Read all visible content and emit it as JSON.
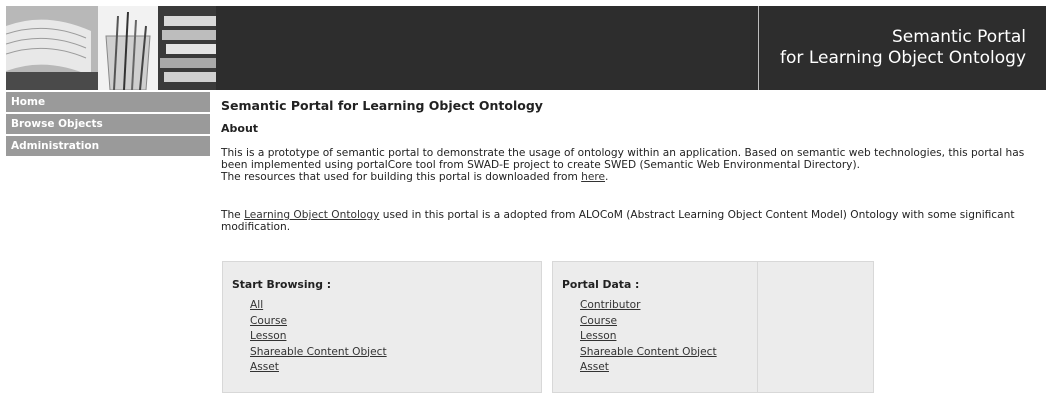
{
  "header": {
    "title_line1": "Semantic Portal",
    "title_line2": "for Learning Object Ontology"
  },
  "sidebar": {
    "items": [
      {
        "label": "Home"
      },
      {
        "label": "Browse Objects"
      },
      {
        "label": "Administration"
      }
    ]
  },
  "main": {
    "title": "Semantic Portal for Learning Object Ontology",
    "about_heading": "About",
    "about_text_1": "This is a prototype of semantic portal to demonstrate the usage of ontology within an application. Based on semantic web technologies, this portal has been implemented using portalCore tool from SWAD-E project to create SWED (Semantic Web Environmental Directory).",
    "about_text_2_prefix": "The resources that used for building this portal is downloaded from ",
    "about_text_2_link": "here",
    "about_text_2_suffix": ".",
    "ontology_prefix": "The ",
    "ontology_link": "Learning Object Ontology",
    "ontology_suffix": " used in this portal is a adopted from ALOCoM (Abstract Learning Object Content Model) Ontology with some significant modification."
  },
  "start_browsing": {
    "title": "Start Browsing :",
    "links": [
      "All",
      "Course",
      "Lesson",
      "Shareable Content Object",
      "Asset"
    ]
  },
  "portal_data": {
    "title": "Portal Data :",
    "links": [
      "Contributor",
      "Course",
      "Lesson",
      "Shareable Content Object",
      "Asset"
    ]
  },
  "colors": {
    "header_bg": "#2d2d2d",
    "nav_bg": "#9a9a9a",
    "box_bg": "#ececec"
  }
}
